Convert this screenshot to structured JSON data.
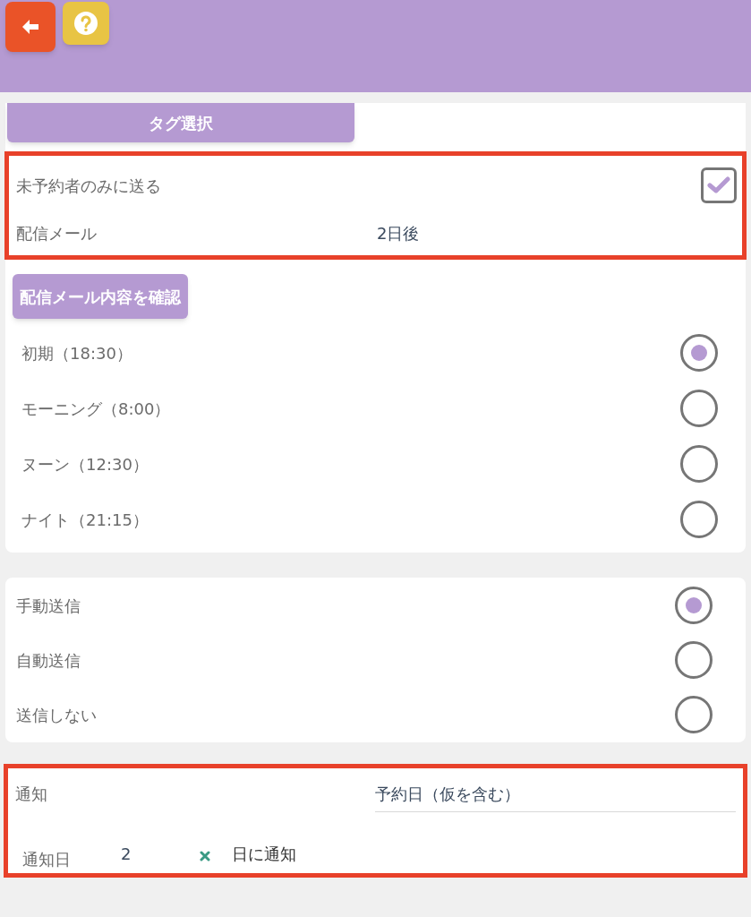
{
  "tag_button": "タグ選択",
  "highlighted_settings": {
    "unreserved_only": {
      "label": "未予約者のみに送る",
      "checked": true
    },
    "delivery_mail": {
      "label": "配信メール",
      "value": "2日後"
    }
  },
  "confirm_button": "配信メール内容を確認",
  "time_options": [
    {
      "label": "初期（18:30）",
      "selected": true
    },
    {
      "label": "モーニング（8:00）",
      "selected": false
    },
    {
      "label": "ヌーン（12:30）",
      "selected": false
    },
    {
      "label": "ナイト（21:15）",
      "selected": false
    }
  ],
  "send_options": [
    {
      "label": "手動送信",
      "selected": true
    },
    {
      "label": "自動送信",
      "selected": false
    },
    {
      "label": "送信しない",
      "selected": false
    }
  ],
  "notification": {
    "label": "通知",
    "value": "予約日（仮を含む）",
    "day_label": "通知日",
    "day_value": "2",
    "day_suffix": "日に通知"
  }
}
